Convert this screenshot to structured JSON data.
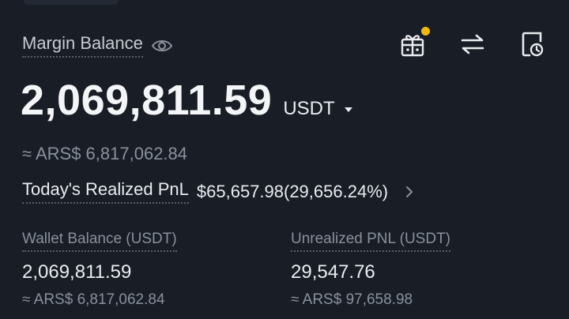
{
  "header": {
    "margin_label": "Margin Balance"
  },
  "balance": {
    "amount": "2,069,811.59",
    "currency": "USDT",
    "fiat_approx": "≈ ARS$ 6,817,062.84"
  },
  "pnl": {
    "label": "Today's Realized PnL",
    "value": "$65,657.98(29,656.24%)"
  },
  "wallet": {
    "label": "Wallet Balance (USDT)",
    "value": "2,069,811.59",
    "fiat": "≈ ARS$ 6,817,062.84"
  },
  "unrealized": {
    "label": "Unrealized PNL (USDT)",
    "value": "29,547.76",
    "fiat": "≈ ARS$ 97,658.98"
  },
  "icons": {
    "visibility": "eye-icon",
    "gift": "gift-icon",
    "transfer": "transfer-icon",
    "history": "history-icon",
    "more": "chevron-right-icon"
  },
  "colors": {
    "background": "#181d26",
    "primary_text": "#eaecef",
    "secondary_text": "#8a919c",
    "notification": "#f0b90b"
  }
}
